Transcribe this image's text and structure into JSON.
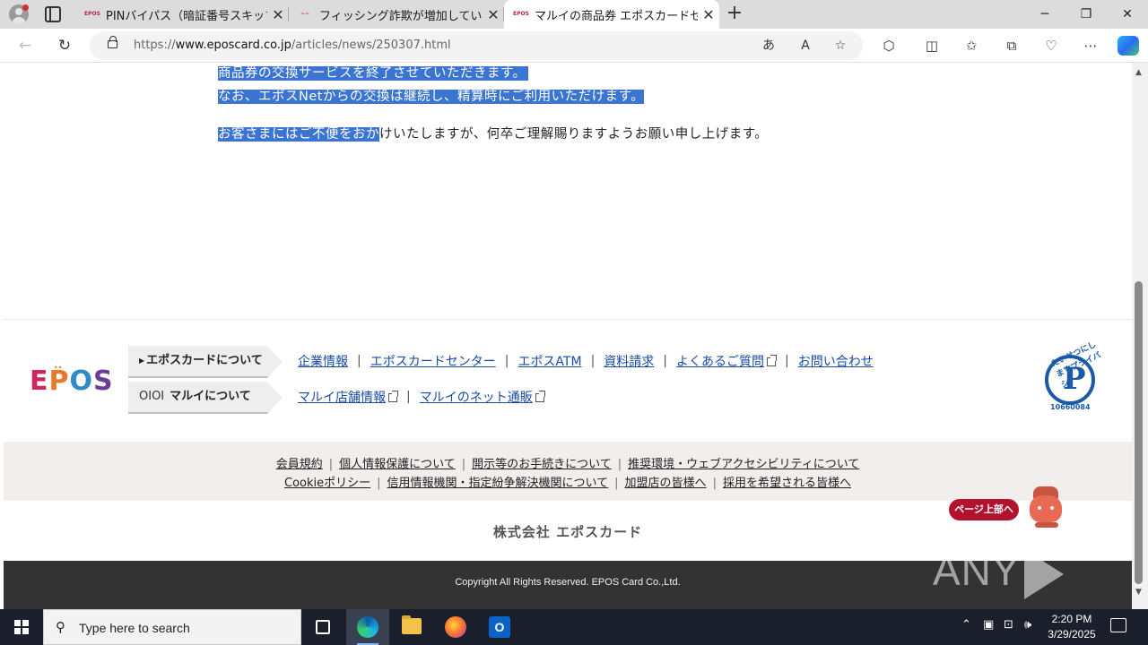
{
  "browser": {
    "tabs": [
      {
        "favicon": "EPOS",
        "title": "PINバイパス（暗証番号スキップ機能",
        "close": "✕"
      },
      {
        "favicon": "~~",
        "title": "フィッシング詐欺が増加しています | ク",
        "close": "✕"
      },
      {
        "favicon": "EPOS",
        "title": "マルイの商品券 エポスカードセンターで",
        "close": "✕"
      }
    ],
    "new_tab": "+",
    "window_controls": {
      "minimize": "─",
      "restore": "❐",
      "close": "✕"
    },
    "url_prefix": "https://",
    "url_host": "www.eposcard.co.jp",
    "url_path": "/articles/news/250307.html"
  },
  "article": {
    "line1": "商品券の交換サービスを終了させていただきます。",
    "line2": "なお、エポスNetからの交換は継続し、精算時にご利用いただけます。",
    "line3_selected": "お客さまにはご不便をおか",
    "line3_rest": "けいたしますが、何卒ご理解賜りますようお願い申し上げます。"
  },
  "footer": {
    "logo": {
      "e": "E",
      "p": "P",
      "o": "O",
      "s": "S",
      "dots": "••"
    },
    "nav1": {
      "label": "エポスカードについて"
    },
    "nav2": {
      "mark": "OIOI",
      "label": "マルイについて"
    },
    "links_row1": [
      "企業情報",
      "エポスカードセンター",
      "エポスATM",
      "資料請求",
      "よくあるご質問",
      "お問い合わせ"
    ],
    "links_row2": [
      "マルイ店舗情報",
      "マルイのネット通販"
    ],
    "privacy": {
      "arc": "たいせつにしますプライバシー",
      "mark": "P",
      "number": "10660084"
    },
    "gray_row1": [
      "会員規約",
      "個人情報保護について",
      "開示等のお手続きについて",
      "推奨環境・ウェブアクセシビリティについて"
    ],
    "gray_row2": [
      "Cookieポリシー",
      "信用情報機関・指定紛争解決機関について",
      "加盟店の皆様へ",
      "採用を希望される皆様へ"
    ],
    "page_top": "ページ上部へ",
    "company": "株式会社 エポスカード",
    "copyright": "Copyright All Rights Reserved. EPOS Card Co.,Ltd.",
    "watermark_left": "ANY",
    "watermark_right": "RUN"
  },
  "taskbar": {
    "search_placeholder": "Type here to search",
    "time": "2:20 PM",
    "date": "3/29/2025"
  },
  "colors": {
    "selection": "#3b74d1",
    "link": "#1a4aa5",
    "footer_dark": "#333333",
    "gray_band": "#f2eeee",
    "page_top_button": "#b3122f"
  }
}
